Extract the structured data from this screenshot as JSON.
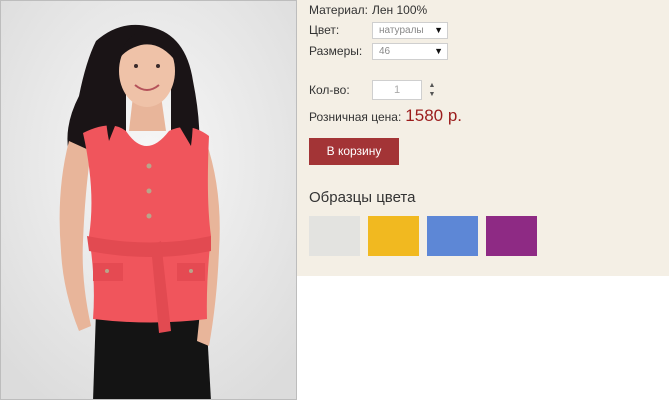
{
  "product": {
    "material_label": "Материал:",
    "material_value": "Лен 100%",
    "color_label": "Цвет:",
    "color_selected": "натуралы",
    "size_label": "Размеры:",
    "size_selected": "46",
    "qty_label": "Кол-во:",
    "qty_value": "1",
    "price_label": "Розничная цена:",
    "price_value": "1580 р.",
    "add_to_cart_label": "В корзину"
  },
  "samples": {
    "title": "Образцы цвета",
    "colors": [
      "#e3e3e0",
      "#f1b920",
      "#5d87d6",
      "#8e2a84"
    ]
  },
  "icons": {
    "dropdown": "dropdown-arrow-icon",
    "stepper": "up-down-stepper-icon"
  },
  "colors": {
    "page_bg": "#f4efe5",
    "button_bg": "#a33436",
    "price": "#9b1c1c"
  }
}
